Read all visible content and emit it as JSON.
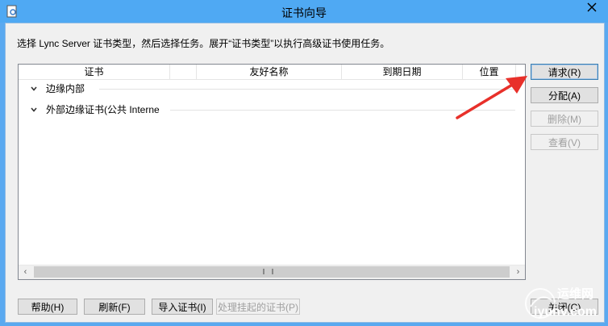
{
  "window": {
    "title": "证书向导"
  },
  "instruction": "选择 Lync Server 证书类型，然后选择任务。展开“证书类型”以执行高级证书使用任务。",
  "columns": [
    "证书",
    "",
    "友好名称",
    "到期日期",
    "位置"
  ],
  "groups": [
    {
      "label": "边缘内部"
    },
    {
      "label": "外部边缘证书(公共 Interne"
    }
  ],
  "side_buttons": [
    {
      "label": "请求(R)",
      "enabled": true
    },
    {
      "label": "分配(A)",
      "enabled": true
    },
    {
      "label": "删除(M)",
      "enabled": false
    },
    {
      "label": "查看(V)",
      "enabled": false
    }
  ],
  "bottom_buttons": [
    {
      "label": "帮助(H)",
      "enabled": true
    },
    {
      "label": "刷新(F)",
      "enabled": true
    },
    {
      "label": "导入证书(I)",
      "enabled": true
    },
    {
      "label": "处理挂起的证书(P)",
      "enabled": false
    }
  ],
  "close_button": "关闭(C)",
  "watermark": {
    "line1": "运维网",
    "line2": "iyunv.com"
  },
  "colors": {
    "titlebar": "#4fa9f3",
    "arrow": "#e8302a"
  }
}
